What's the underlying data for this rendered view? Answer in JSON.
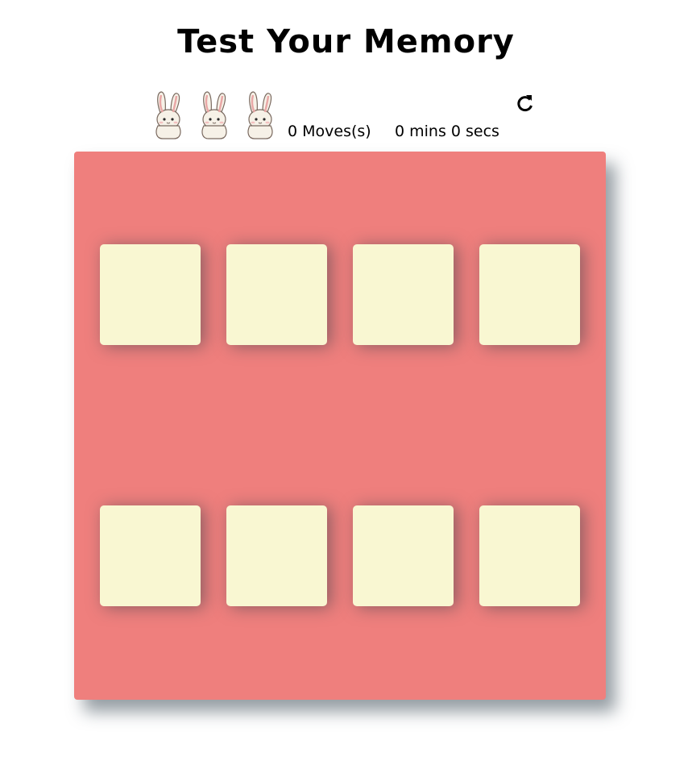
{
  "title": "Test Your Memory",
  "score_panel": {
    "stars": [
      {
        "icon": "bunny-icon"
      },
      {
        "icon": "bunny-icon"
      },
      {
        "icon": "bunny-icon"
      }
    ],
    "moves_text": "0 Moves(s)",
    "timer_text": "0 mins 0 secs",
    "restart_icon": "restart-icon"
  },
  "deck": {
    "color": "#ef7f7d",
    "card_color": "#f9f7d2",
    "cards": [
      {
        "state": "hidden"
      },
      {
        "state": "hidden"
      },
      {
        "state": "hidden"
      },
      {
        "state": "hidden"
      },
      {
        "state": "hidden"
      },
      {
        "state": "hidden"
      },
      {
        "state": "hidden"
      },
      {
        "state": "hidden"
      }
    ]
  }
}
